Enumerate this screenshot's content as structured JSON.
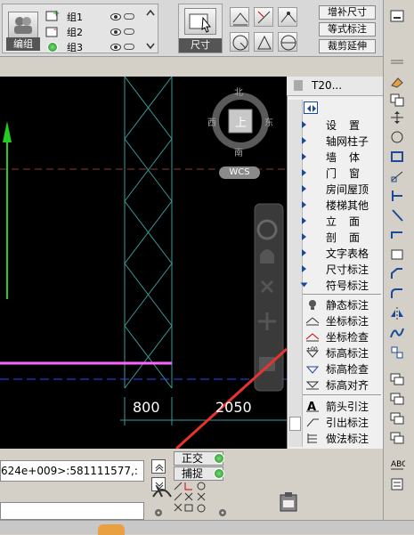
{
  "toolbar": {
    "group_label": "编组",
    "groups": [
      {
        "name": "组1"
      },
      {
        "name": "组2"
      },
      {
        "name": "组3"
      }
    ],
    "dimension_label": "尺寸",
    "buttons": [
      "增补尺寸",
      "等式标注",
      "裁剪延伸"
    ]
  },
  "panel": {
    "title": "T20...",
    "menu_items": [
      "设置",
      "轴网柱子",
      "墙体",
      "门窗",
      "房间屋顶",
      "楼梯其他",
      "立面",
      "剖面",
      "文字表格",
      "尺寸标注",
      "符号标注"
    ],
    "sub_items": [
      "静态标注",
      "坐标标注",
      "坐标检查",
      "标高标注",
      "标高检查",
      "标高对齐",
      "箭头引注",
      "引出标注",
      "做法标注"
    ]
  },
  "viewcube": {
    "north": "北",
    "south": "南",
    "east": "东",
    "west": "西",
    "top": "上",
    "wcs": "WCS"
  },
  "dimensions": [
    "800",
    "2050"
  ],
  "command_line": {
    "text": "624e+009>:581111577,:"
  },
  "snap": {
    "ortho": "正交",
    "capture": "捕捉"
  },
  "colors": {
    "accent_arrow": "#e8332f",
    "canvas_bg": "#000000",
    "hatch": "#3a9a9a",
    "magenta_line": "#ff66ff",
    "green_axis": "#22cc22"
  }
}
